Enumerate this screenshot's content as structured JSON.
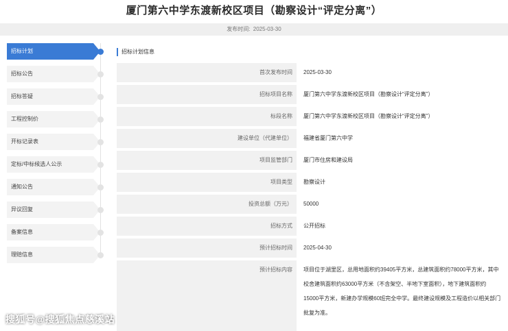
{
  "page": {
    "title": "厦门第六中学东渡新校区项目（勘察设计“评定分离”）",
    "publish_label": "发布时间:",
    "publish_date": "2025-03-30"
  },
  "sidebar": {
    "items": [
      {
        "label": "招标计划",
        "active": true
      },
      {
        "label": "招标公告",
        "active": false
      },
      {
        "label": "招标答疑",
        "active": false
      },
      {
        "label": "工程控制价",
        "active": false
      },
      {
        "label": "开标记录表",
        "active": false
      },
      {
        "label": "定标/中标候选人公示",
        "active": false
      },
      {
        "label": "通知公告",
        "active": false
      },
      {
        "label": "异议回复",
        "active": false
      },
      {
        "label": "备案信息",
        "active": false
      },
      {
        "label": "理赔信息",
        "active": false
      }
    ]
  },
  "section": {
    "title": "招标计划信息"
  },
  "table": {
    "rows": [
      {
        "label": "首次发布时间",
        "value": "2025-03-30"
      },
      {
        "label": "招标项目名称",
        "value": "厦门第六中学东渡新校区项目（勘察设计“评定分离”）"
      },
      {
        "label": "标段名称",
        "value": "厦门第六中学东渡新校区项目（勘察设计“评定分离”）"
      },
      {
        "label": "建设单位（代建单位）",
        "value": "福建省厦门第六中学"
      },
      {
        "label": "项目监管部门",
        "value": "厦门市住房和建设局"
      },
      {
        "label": "项目类型",
        "value": "勘察设计"
      },
      {
        "label": "投资总额（万元）",
        "value": "50000"
      },
      {
        "label": "招标方式",
        "value": "公开招标"
      },
      {
        "label": "预计招标时间",
        "value": "2025-04-30"
      },
      {
        "label": "预计招标内容",
        "value": "项目位于湖里区，总用地面积约39405平方米，总建筑面积约78000平方米，其中校舍建筑面积约63000平方米（不含架空、半地下室面积），地下建筑面积约15000平方米，新建办学规模60班完全中学。最终建设规模及工程造价以相关部门批复为准。"
      }
    ]
  },
  "watermark": "搜狐号@搜狐焦点慈溪站",
  "colors": {
    "accent": "#3a7bd5",
    "label_bg": "#f1f1f1",
    "sidebar_bg": "#f3f3f3"
  }
}
